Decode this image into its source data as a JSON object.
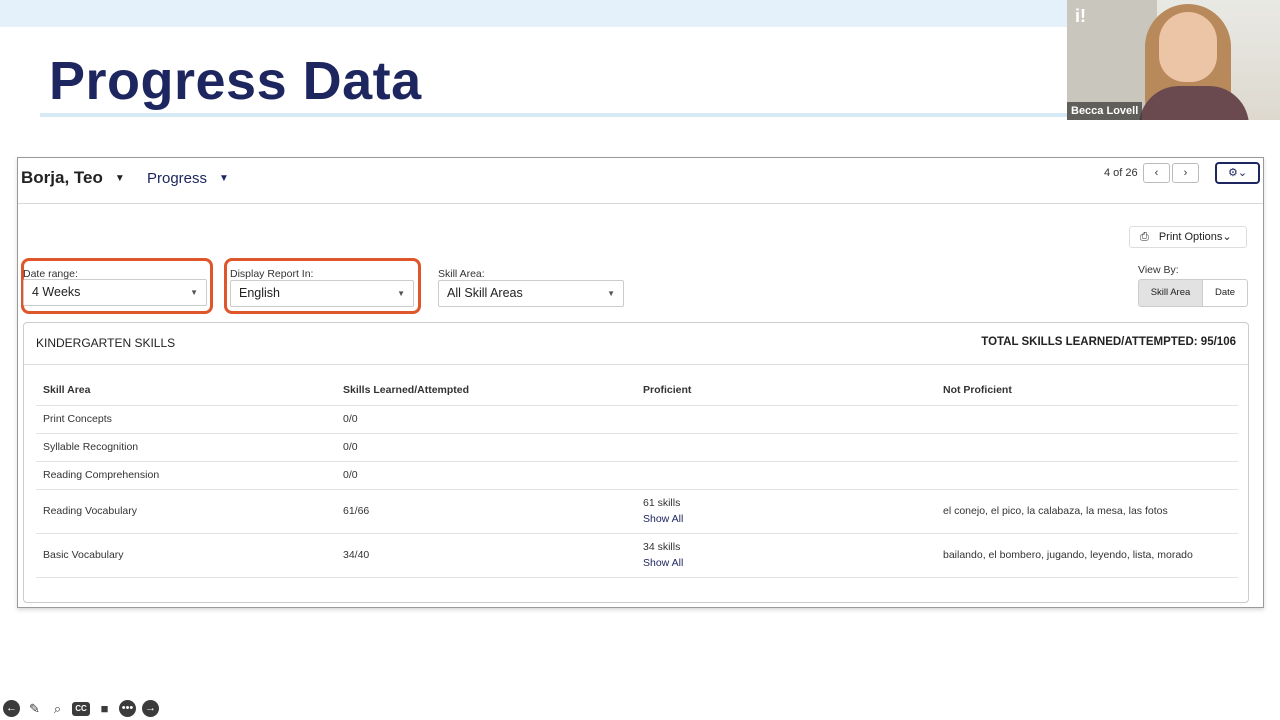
{
  "slide": {
    "title": "Progress Data"
  },
  "video": {
    "logo_text": "i!",
    "presenter_name": "Becca Lovell"
  },
  "header": {
    "student_name": "Borja, Teo",
    "student_caret": "▼",
    "report_type": "Progress",
    "report_caret": "▼",
    "counter": "4 of 26",
    "prev_glyph": "‹",
    "next_glyph": "›",
    "settings_glyph": "⚙⌄"
  },
  "print": {
    "label": "Print Options",
    "icon_glyph": "⎙",
    "caret": "⌄"
  },
  "filters": {
    "date_range": {
      "label": "Date range:",
      "value": "4 Weeks",
      "arrow": "▼"
    },
    "display_report": {
      "label": "Display Report In:",
      "value": "English",
      "arrow": "▼"
    },
    "skill_area": {
      "label": "Skill Area:",
      "value": "All Skill Areas",
      "arrow": "▼"
    }
  },
  "view_by": {
    "label": "View By:",
    "options": [
      "Skill Area",
      "Date"
    ],
    "selected": "Skill Area"
  },
  "panel": {
    "title": "KINDERGARTEN SKILLS",
    "total": "TOTAL SKILLS LEARNED/ATTEMPTED: 95/106",
    "columns": [
      "Skill Area",
      "Skills Learned/Attempted",
      "Proficient",
      "Not Proficient"
    ],
    "rows": [
      {
        "area": "Print Concepts",
        "learned": "0/0",
        "proficient": "",
        "show_all": "",
        "not_proficient": ""
      },
      {
        "area": "Syllable Recognition",
        "learned": "0/0",
        "proficient": "",
        "show_all": "",
        "not_proficient": ""
      },
      {
        "area": "Reading Comprehension",
        "learned": "0/0",
        "proficient": "",
        "show_all": "",
        "not_proficient": ""
      },
      {
        "area": "Reading Vocabulary",
        "learned": "61/66",
        "proficient": "61 skills",
        "show_all": "Show All",
        "not_proficient": "el conejo, el pico, la calabaza, la mesa, las fotos"
      },
      {
        "area": "Basic Vocabulary",
        "learned": "34/40",
        "proficient": "34 skills",
        "show_all": "Show All",
        "not_proficient": "bailando, el bombero, jugando, leyendo, lista, morado"
      }
    ]
  },
  "colors": {
    "accent": "#1e2660",
    "highlight": "#e0562b",
    "band": "#e4f1fa"
  },
  "toolbar_icons": [
    "back-arrow-icon",
    "pen-icon",
    "magnifier-icon",
    "captions-icon",
    "camera-icon",
    "more-icon",
    "forward-arrow-icon"
  ]
}
